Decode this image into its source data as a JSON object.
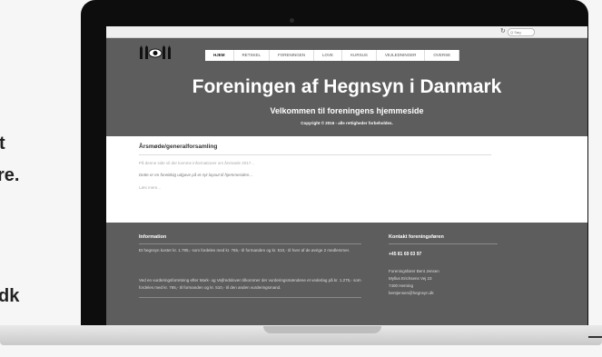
{
  "background": {
    "lines": [
      "t",
      "re.",
      "dk"
    ]
  },
  "browser": {
    "reload_icon": "↻",
    "search_placeholder": "Q Søg"
  },
  "site": {
    "nav": [
      "HJEM",
      "RETSKEL",
      "FORENINGEN",
      "LOVE",
      "KURSUS",
      "VEJLEDNINGER",
      "OVERSE"
    ],
    "title": "Foreningen af Hegnsyn i Danmark",
    "subtitle": "Velkommen til foreningens hjemmeside",
    "copyright": "Copyright © 2016 - alle rettigheder forbeholdes."
  },
  "post": {
    "title": "Årsmøde/generalforsamling",
    "meta": "På denne side vil der komme informationer om årsmøde 2017...",
    "excerpt": "Dette er en foreløbig udgave på et nyt layout til hjemmesiden...",
    "more": "Læs mere..."
  },
  "footer": {
    "info_heading": "Information",
    "info_text_1": "Et hegnsyn koster kr. 1.785,- som fordeles med kr. 765,- til formanden og kr. 510,- til hver af de øvrige 2 medlemmer.",
    "info_text_2": "Ved en vurderingsforretning efter Mark- og Vejfredsloven tilkommer der vurderingsmændene et vederlag på kr. 1.275,- som fordeles med kr. 765,- til formanden og kr. 510,- til den anden vurderingsmand.",
    "contact_heading": "Kontakt foreningsføren",
    "phone": "+45 81 69 03 97",
    "contact_lines": [
      "Foreningsfører Bent Jensen",
      "Myllus Erichsens Vej 23",
      "7400 Herning",
      "bentjensen@hegnsyn.dk"
    ]
  },
  "colors": {
    "screen_bg": "#5d5d5d",
    "content_bg": "#ffffff",
    "laptop_bezel": "#0d0d0d"
  }
}
